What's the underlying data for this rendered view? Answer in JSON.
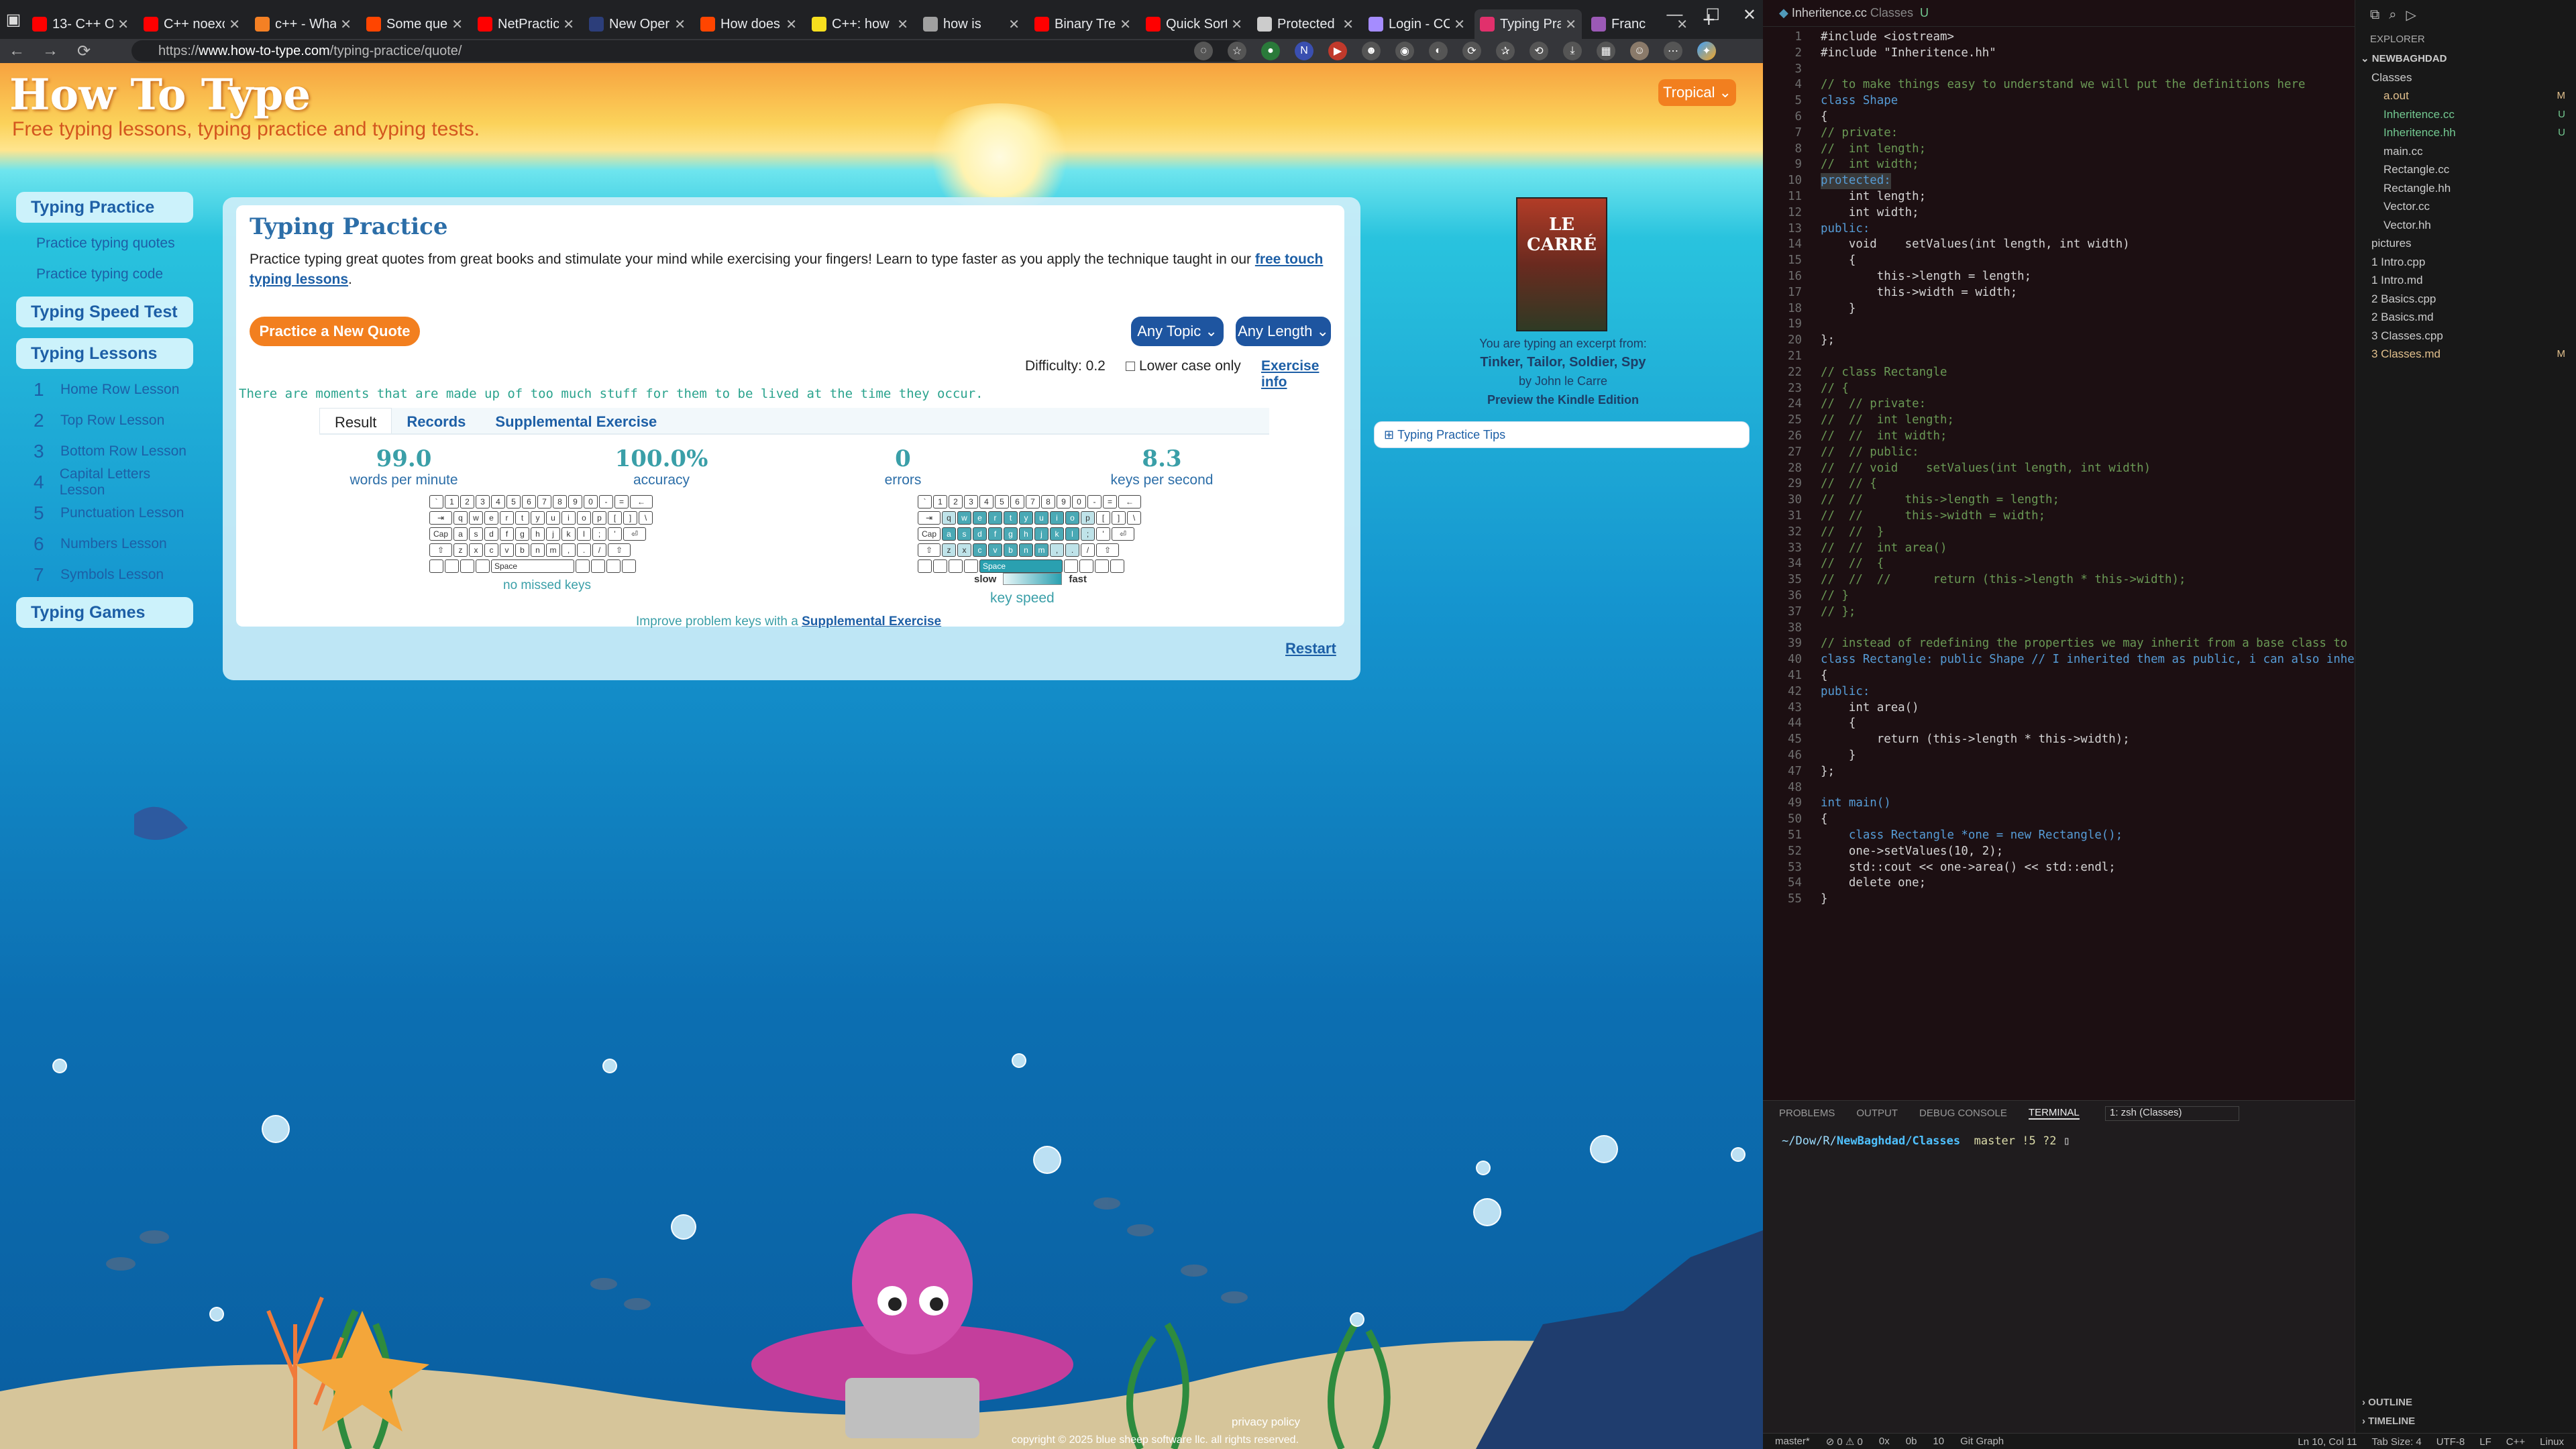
{
  "browser": {
    "tabs": [
      {
        "title": "13- C++ OO",
        "color": "#ff0000"
      },
      {
        "title": "C++ noexcept",
        "color": "#ff0000"
      },
      {
        "title": "c++ - What",
        "color": "#f48024"
      },
      {
        "title": "Some ques",
        "color": "#ff4500"
      },
      {
        "title": "NetPractice",
        "color": "#ff0000"
      },
      {
        "title": "New Oper",
        "color": "#2c3e7a"
      },
      {
        "title": "How does",
        "color": "#ff4500"
      },
      {
        "title": "C++: how",
        "color": "#f7df1e"
      },
      {
        "title": "how is",
        "color": "#a0a0a0"
      },
      {
        "title": "Binary Tre",
        "color": "#ff0000"
      },
      {
        "title": "Quick Sort",
        "color": "#ff0000"
      },
      {
        "title": "Protected",
        "color": "#cccccc"
      },
      {
        "title": "Login - CC",
        "color": "#a58cff"
      },
      {
        "title": "Typing Pra",
        "color": "#e1306c"
      },
      {
        "title": "Franc",
        "color": "#9b59b6"
      }
    ],
    "url_prefix": "https://",
    "url_domain": "www.how-to-type.com",
    "url_path": "/typing-practice/quote/"
  },
  "site": {
    "logo": "How To Type",
    "tagline": "Free typing lessons, typing practice and typing tests.",
    "theme": "Tropical",
    "sidebar": {
      "practice_header": "Typing Practice",
      "practice_links": [
        "Practice typing quotes",
        "Practice typing code"
      ],
      "speed_test": "Typing Speed Test",
      "lessons_header": "Typing Lessons",
      "lessons": [
        {
          "num": "1",
          "label": "Home Row Lesson"
        },
        {
          "num": "2",
          "label": "Top Row Lesson"
        },
        {
          "num": "3",
          "label": "Bottom Row Lesson"
        },
        {
          "num": "4",
          "label": "Capital Letters Lesson"
        },
        {
          "num": "5",
          "label": "Punctuation Lesson"
        },
        {
          "num": "6",
          "label": "Numbers Lesson"
        },
        {
          "num": "7",
          "label": "Symbols Lesson"
        }
      ],
      "games": "Typing Games"
    },
    "title": "Typing Practice",
    "description": "Practice typing great quotes from great books and stimulate your mind while exercising your fingers! Learn to type faster as you apply the technique taught in our ",
    "description_link": "free touch typing lessons",
    "description_end": ".",
    "new_quote_button": "Practice a New Quote",
    "topic": "Any Topic",
    "length": "Any Length",
    "difficulty": "Difficulty: 0.2",
    "lowercase_label": "Lower case only",
    "exercise_info": "Exercise info",
    "quote": "There are moments that are made up of too much stuff for them to be lived at the time they occur.",
    "result_tabs": [
      "Result",
      "Records",
      "Supplemental Exercise"
    ],
    "stats": [
      {
        "value": "99.0",
        "label": "words per minute"
      },
      {
        "value": "100.0%",
        "label": "accuracy"
      },
      {
        "value": "0",
        "label": "errors"
      },
      {
        "value": "8.3",
        "label": "keys per second"
      }
    ],
    "keyboard_caption_1": "no missed keys",
    "keyboard_caption_2": "key speed",
    "speed_slow": "slow",
    "speed_fast": "fast",
    "space_key": "Space",
    "improve_text": "Improve problem keys with a ",
    "improve_link": "Supplemental Exercise",
    "restart": "Restart",
    "book_caption_intro": "You are typing an excerpt from:",
    "book_title": "Tinker, Tailor, Soldier, Spy",
    "book_author": "by John le Carre",
    "book_preview": "Preview the Kindle Edition",
    "book_cover_text": "LE CARRÉ",
    "tips": "Typing Practice Tips",
    "privacy": "privacy policy",
    "copyright": "copyright © 2025 blue sheep software llc. all rights reserved."
  },
  "vscode": {
    "editor_tab": "Inheritence.cc",
    "editor_tab_path": "Classes",
    "editor_tab_status": "U",
    "code_lines": [
      "#include <iostream>",
      "#include \"Inheritence.hh\"",
      "",
      "// to make things easy to understand we will put the definitions here",
      "class Shape",
      "{",
      "// private:",
      "//  int length;",
      "//  int width;",
      "protected:",
      "    int length;",
      "    int width;",
      "public:",
      "    void    setValues(int length, int width)",
      "    {",
      "        this->length = length;",
      "        this->width = width;",
      "    }",
      "",
      "};",
      "",
      "// class Rectangle",
      "// {",
      "//  // private:",
      "//  //  int length;",
      "//  //  int width;",
      "//  // public:",
      "//  // void    setValues(int length, int width)",
      "//  // {",
      "//  //      this->length = length;",
      "//  //      this->width = width;",
      "//  //  }",
      "//  //  int area()",
      "//  //  {",
      "//  //  //      return (this->length * this->width);",
      "// }",
      "// };",
      "",
      "// instead of redefining the properties we may inherit from a base class to",
      "class Rectangle: public Shape // I inherited them as public, i can also inhe",
      "{",
      "public:",
      "    int area()",
      "    {",
      "        return (this->length * this->width);",
      "    }",
      "};",
      "",
      "int main()",
      "{",
      "    class Rectangle *one = new Rectangle();",
      "    one->setValues(10, 2);",
      "    std::cout << one->area() << std::endl;",
      "    delete one;",
      "}"
    ],
    "explorer_title": "EXPLORER",
    "workspace": "NEWBAGHDAD",
    "tree": [
      {
        "label": "Classes",
        "indent": 1,
        "badge": "",
        "cls": ""
      },
      {
        "label": "a.out",
        "indent": 2,
        "badge": "M",
        "cls": "y"
      },
      {
        "label": "Inheritence.cc",
        "indent": 2,
        "badge": "U",
        "cls": "g"
      },
      {
        "label": "Inheritence.hh",
        "indent": 2,
        "badge": "U",
        "cls": "g"
      },
      {
        "label": "main.cc",
        "indent": 2,
        "badge": "",
        "cls": ""
      },
      {
        "label": "Rectangle.cc",
        "indent": 2,
        "badge": "",
        "cls": ""
      },
      {
        "label": "Rectangle.hh",
        "indent": 2,
        "badge": "",
        "cls": ""
      },
      {
        "label": "Vector.cc",
        "indent": 2,
        "badge": "",
        "cls": ""
      },
      {
        "label": "Vector.hh",
        "indent": 2,
        "badge": "",
        "cls": ""
      },
      {
        "label": "pictures",
        "indent": 1,
        "badge": "",
        "cls": ""
      },
      {
        "label": "1 Intro.cpp",
        "indent": 1,
        "badge": "",
        "cls": ""
      },
      {
        "label": "1 Intro.md",
        "indent": 1,
        "badge": "",
        "cls": ""
      },
      {
        "label": "2 Basics.cpp",
        "indent": 1,
        "badge": "",
        "cls": ""
      },
      {
        "label": "2 Basics.md",
        "indent": 1,
        "badge": "",
        "cls": ""
      },
      {
        "label": "3 Classes.cpp",
        "indent": 1,
        "badge": "",
        "cls": ""
      },
      {
        "label": "3 Classes.md",
        "indent": 1,
        "badge": "M",
        "cls": "y"
      }
    ],
    "outline": "OUTLINE",
    "timeline": "TIMELINE",
    "panel_tabs": [
      "PROBLEMS",
      "OUTPUT",
      "DEBUG CONSOLE",
      "TERMINAL"
    ],
    "terminal_select": "1: zsh (Classes)",
    "terminal_path": "~/Dow/R/",
    "terminal_dir": "NewBaghdad/Classes",
    "terminal_git": "master !5 ?2",
    "status_left": [
      "master*",
      "⊘ 0 ⚠ 0",
      "0x",
      "0b",
      "10",
      "Git Graph"
    ],
    "status_right": [
      "Ln 10, Col 11",
      "Tab Size: 4",
      "UTF-8",
      "LF",
      "C++",
      "Linux"
    ]
  }
}
